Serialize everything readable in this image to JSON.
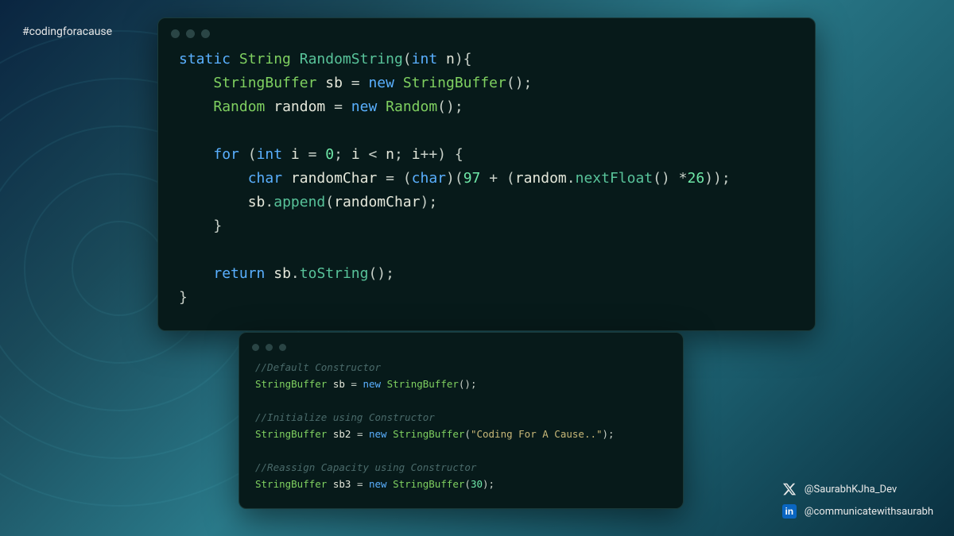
{
  "hashtag": "#codingforacause",
  "main_code": {
    "l1_static": "static",
    "l1_type": "String",
    "l1_fn": "RandomString",
    "l1_int": "int",
    "l1_n": "n",
    "sb_type": "StringBuffer",
    "sb_var": "sb",
    "new_kw": "new",
    "random_type": "Random",
    "random_var": "random",
    "for_kw": "for",
    "int_kw": "int",
    "i_var": "i",
    "zero": "0",
    "char_kw": "char",
    "rc_var": "randomChar",
    "n97": "97",
    "nextfloat": "nextFloat",
    "n26": "26",
    "append": "append",
    "return_kw": "return",
    "tostring": "toString"
  },
  "secondary_code": {
    "c1": "//Default Constructor",
    "sb_type": "StringBuffer",
    "sb_var": "sb",
    "new_kw": "new",
    "c2": "//Initialize using Constructor",
    "sb2_var": "sb2",
    "str1": "\"Coding For A Cause..\"",
    "c3": "//Reassign Capacity using Constructor",
    "sb3_var": "sb3",
    "n30": "30"
  },
  "socials": {
    "twitter": "@SaurabhKJha_Dev",
    "linkedin": "@communicatewithsaurabh"
  }
}
